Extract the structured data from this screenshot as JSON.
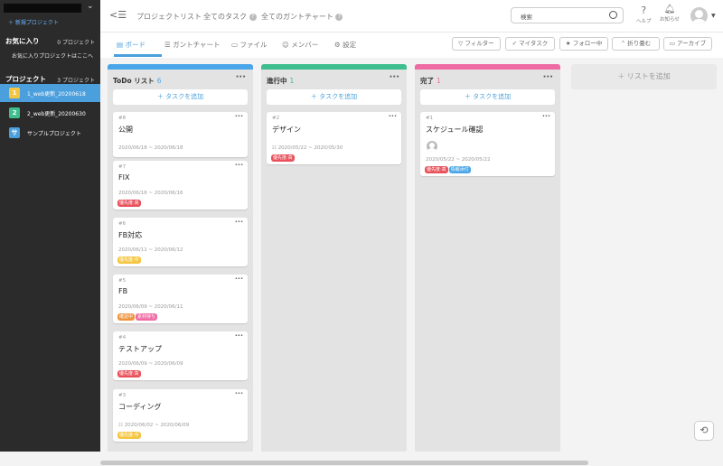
{
  "sidebar": {
    "new_project": "新規プロジェクト",
    "favorites": {
      "title": "お気に入り",
      "count": "0 プロジェクト",
      "hint": "お気に入りプロジェクトはここへ"
    },
    "projects": {
      "title": "プロジェクト",
      "count": "3 プロジェクト",
      "items": [
        {
          "icon": "1",
          "name": "1_web更新_20200618",
          "color": "#f5c542"
        },
        {
          "icon": "2",
          "name": "2_web更新_20200630",
          "color": "#3fbf8f"
        },
        {
          "icon": "サ",
          "name": "サンプルプロジェクト",
          "color": "#4a9fdc"
        }
      ]
    }
  },
  "header": {
    "nav": [
      "プロジェクトリスト",
      "全てのタスク",
      "全てのガントチャート"
    ],
    "search_placeholder": "検索",
    "help_label": "ヘルプ",
    "notify_label": "お知らせ"
  },
  "tabs": [
    "ボード",
    "ガントチャート",
    "ファイル",
    "メンバー",
    "設定"
  ],
  "toolbar": [
    "フィルター",
    "マイタスク",
    "フォロー中",
    "折り畳む",
    "アーカイブ"
  ],
  "board": {
    "add_task": "タスクを追加",
    "add_list": "リストを追加",
    "columns": [
      {
        "title": "ToDo リスト",
        "count": "6",
        "color": "#4aa6e8",
        "cards": [
          {
            "id": "#8",
            "title": "公開",
            "date": "2020/06/18 ~ 2020/06/18",
            "tags": []
          },
          {
            "id": "#7",
            "title": "FIX",
            "date": "2020/06/16 ~ 2020/06/16",
            "tags": [
              {
                "label": "優先度:高",
                "color": "#e8505b"
              }
            ]
          },
          {
            "id": "#6",
            "title": "FB対応",
            "date": "2020/06/11 ~ 2020/06/12",
            "tags": [
              {
                "label": "優先度:中",
                "color": "#f5c542"
              }
            ]
          },
          {
            "id": "#5",
            "title": "FB",
            "date": "2020/06/09 ~ 2020/06/11",
            "tags": [
              {
                "label": "確認中",
                "color": "#f0923b"
              },
              {
                "label": "素材待ち",
                "color": "#ee6ba3"
              }
            ]
          },
          {
            "id": "#4",
            "title": "テストアップ",
            "date": "2020/06/09 ~ 2020/06/09",
            "tags": [
              {
                "label": "優先度:高",
                "color": "#e8505b"
              }
            ]
          },
          {
            "id": "#3",
            "title": "コーディング",
            "date": "2020/06/02 ~ 2020/06/09",
            "tags": [
              {
                "label": "優先度:中",
                "color": "#f5c542"
              }
            ]
          }
        ]
      },
      {
        "title": "進行中",
        "count": "1",
        "color": "#3fbf8f",
        "cards": [
          {
            "id": "#2",
            "title": "デザイン",
            "date": "2020/05/22 ~ 2020/05/30",
            "tags": [
              {
                "label": "優先度:高",
                "color": "#e8505b"
              }
            ]
          }
        ]
      },
      {
        "title": "完了",
        "count": "1",
        "color": "#ee6ba3",
        "cards": [
          {
            "id": "#1",
            "title": "スケジュール確認",
            "date": "2020/05/22 ~ 2020/05/22",
            "tags": [
              {
                "label": "優先度:高",
                "color": "#e8505b"
              },
              {
                "label": "情報添付",
                "color": "#4aa6e8"
              }
            ]
          }
        ]
      }
    ]
  }
}
